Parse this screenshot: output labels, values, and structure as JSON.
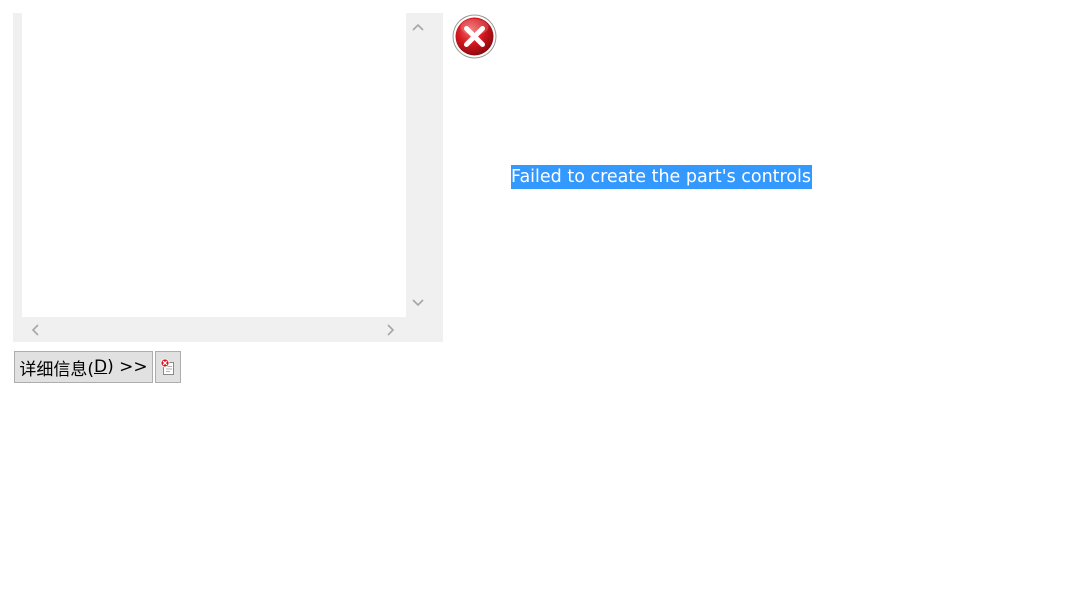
{
  "list": {
    "items": []
  },
  "message": {
    "text": "Failed to create the part's controls",
    "highlight_color": "#3399ff"
  },
  "details_button": {
    "label_prefix": "详细信息(",
    "label_mnemonic": "D",
    "label_suffix": ") >>"
  },
  "icons": {
    "error": "error-x-icon",
    "copy": "copy-error-icon"
  },
  "colors": {
    "error_red": "#c4161c",
    "panel_gray": "#f0f0f0",
    "button_face": "#e1e1e1"
  }
}
